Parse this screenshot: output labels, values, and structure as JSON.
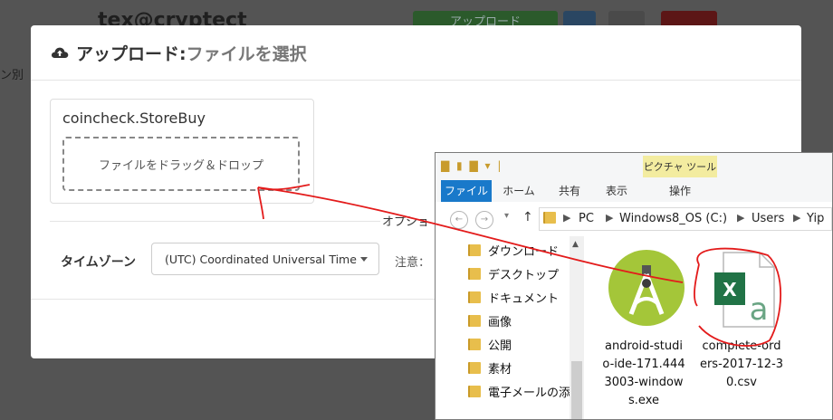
{
  "background": {
    "title": "tex@cryptect",
    "upload_button": "アップロード",
    "left_text": "ン別"
  },
  "modal": {
    "icon": "cloud-upload-icon",
    "title": "アップロード:",
    "subtitle": "ファイルを選択",
    "card_title": "coincheck.StoreBuy",
    "dropzone_text": "ファイルをドラッグ＆ドロップ",
    "options_label": "オプショ",
    "timezone_label": "タイムゾーン",
    "timezone_value": "(UTC) Coordinated Universal Time",
    "note_label": "注意："
  },
  "explorer": {
    "picture_tools": "ピクチャ ツール",
    "tabs": [
      "ファイル",
      "ホーム",
      "共有",
      "表示",
      "操作"
    ],
    "path": [
      "PC",
      "Windows8_OS (C:)",
      "Users",
      "Yip"
    ],
    "nav_items": [
      "ダウンロード",
      "デスクトップ",
      "ドキュメント",
      "画像",
      "公開",
      "素材",
      "電子メールの添"
    ],
    "files": [
      {
        "name_lines": [
          "android-studi",
          "o-ide-171.444",
          "3003-window",
          "s.exe"
        ],
        "icon": "android-studio-icon"
      },
      {
        "name_lines": [
          "complete-ord",
          "ers-2017-12-3",
          "0.csv"
        ],
        "icon": "excel-csv-icon"
      }
    ]
  },
  "colors": {
    "accent_green": "#2b5a2b",
    "danger_red": "#5c1616",
    "file_tab_blue": "#1979ca",
    "annotation_red": "#e31b1b",
    "excel_green": "#217346",
    "android_green": "#a4c639"
  }
}
